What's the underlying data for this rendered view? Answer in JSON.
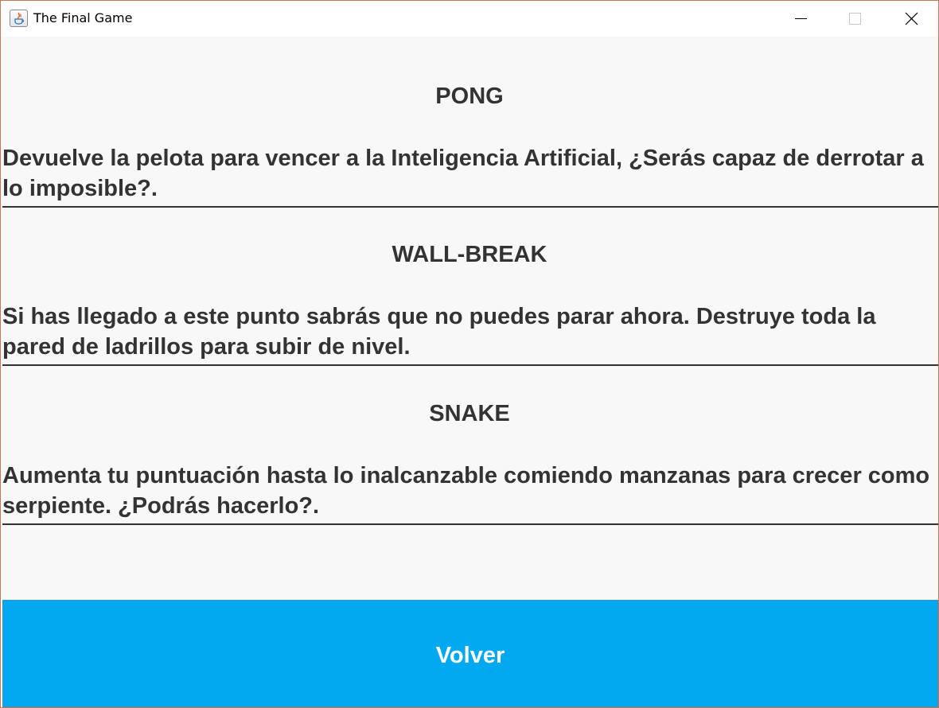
{
  "window": {
    "title": "The Final Game",
    "controls": {
      "minimize": "minimize-icon",
      "maximize": "maximize-icon",
      "close": "close-icon"
    },
    "app_icon": "java-icon"
  },
  "games": [
    {
      "title": "PONG",
      "description": "Devuelve la pelota para vencer a la Inteligencia Artificial, ¿Serás capaz de derrotar a lo imposible?."
    },
    {
      "title": "WALL-BREAK",
      "description": "Si has llegado a este punto sabrás que no puedes parar ahora. Destruye toda la pared de ladrillos para subir de nivel."
    },
    {
      "title": "SNAKE",
      "description": "Aumenta tu puntuación hasta lo inalcanzable comiendo manzanas para crecer como serpiente. ¿Podrás hacerlo?."
    }
  ],
  "back_button": {
    "label": "Volver"
  },
  "colors": {
    "button_bg": "#03a9f0",
    "text": "#333333",
    "background": "#f8f8f8"
  }
}
